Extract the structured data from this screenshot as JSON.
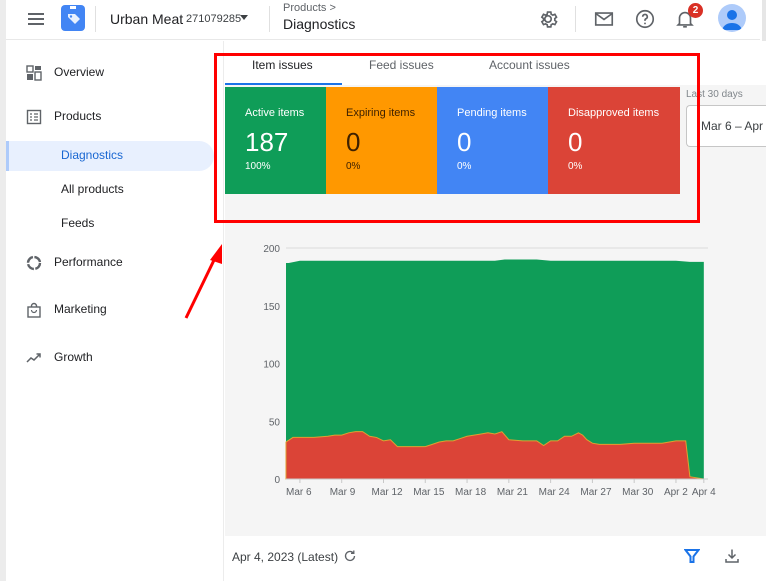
{
  "header": {
    "menu_icon": "hamburger-menu-icon",
    "logo_icon": "merchant-center-tag-icon",
    "account_name": "Urban Meat",
    "account_id": "271079285",
    "breadcrumb_parent": "Products >",
    "page_title": "Diagnostics",
    "icons": [
      "gear-icon",
      "mail-icon",
      "help-icon",
      "bell-icon",
      "avatar"
    ],
    "notification_count": "2"
  },
  "sidebar": {
    "items": [
      {
        "label": "Overview",
        "icon": "dashboard-icon"
      },
      {
        "label": "Products",
        "icon": "list-icon"
      },
      {
        "label": "Diagnostics",
        "sub": true,
        "active": true
      },
      {
        "label": "All products",
        "sub": true
      },
      {
        "label": "Feeds",
        "sub": true
      },
      {
        "label": "Performance",
        "icon": "donut-icon"
      },
      {
        "label": "Marketing",
        "icon": "shopping-bag-icon"
      },
      {
        "label": "Growth",
        "icon": "trending-up-icon"
      }
    ]
  },
  "tabs": [
    {
      "label": "Item issues",
      "active": true
    },
    {
      "label": "Feed issues"
    },
    {
      "label": "Account issues"
    }
  ],
  "cards": [
    {
      "label": "Active items",
      "value": "187",
      "pct": "100%",
      "color": "#0f9d58"
    },
    {
      "label": "Expiring items",
      "value": "0",
      "pct": "0%",
      "color": "#ff9800"
    },
    {
      "label": "Pending items",
      "value": "0",
      "pct": "0%",
      "color": "#4285f4"
    },
    {
      "label": "Disapproved items",
      "value": "0",
      "pct": "0%",
      "color": "#db4437"
    }
  ],
  "date_range": {
    "label": "Last 30 days",
    "value": "Mar 6 – Apr"
  },
  "footer": {
    "date": "Apr 4, 2023 (Latest)",
    "icons": [
      "refresh-icon",
      "filter-icon",
      "download-icon"
    ]
  },
  "chart_data": {
    "type": "area",
    "title": "",
    "xlabel": "",
    "ylabel": "",
    "ylim": [
      0,
      200
    ],
    "yticks": [
      0,
      50,
      100,
      150,
      200
    ],
    "grid": true,
    "x_start": "Mar 5",
    "x_end": "Apr 4",
    "xtick_labels": [
      "Mar 6",
      "Mar 9",
      "Mar 12",
      "Mar 15",
      "Mar 18",
      "Mar 21",
      "Mar 24",
      "Mar 27",
      "Mar 30",
      "Apr 2",
      "Apr 4"
    ],
    "xtick_days": [
      1,
      4,
      7,
      10,
      13,
      16,
      19,
      22,
      25,
      28,
      30
    ],
    "series": [
      {
        "name": "Active items",
        "color": "#0f9d58",
        "x": [
          0,
          0.2,
          1,
          2,
          3,
          4,
          5,
          6,
          7,
          8,
          9,
          10,
          11,
          12,
          13,
          14,
          15,
          15.7,
          16,
          17,
          18,
          19,
          20,
          21,
          22,
          23,
          24,
          25,
          26,
          27,
          28,
          29,
          30
        ],
        "values": [
          187,
          187,
          189,
          189,
          189,
          189,
          189,
          189,
          189,
          189,
          189,
          189,
          189,
          189,
          189,
          189,
          189,
          190,
          190,
          190,
          190,
          189,
          189,
          189,
          189,
          189,
          189,
          189,
          189,
          189,
          189,
          188,
          188
        ]
      },
      {
        "name": "Disapproved items",
        "color": "#db4437",
        "x": [
          0,
          0.5,
          1,
          2,
          3,
          3.5,
          4,
          4.5,
          5,
          5.5,
          6,
          6.5,
          7,
          7.5,
          8,
          9,
          10,
          10.5,
          11,
          11.5,
          12,
          12.5,
          13,
          13.5,
          14,
          14.5,
          15,
          15.5,
          16,
          17,
          18,
          18.5,
          19,
          19.5,
          20,
          20.5,
          21,
          21.3,
          21.6,
          22,
          22.5,
          23,
          24,
          25,
          26,
          27,
          28,
          28.7,
          29,
          30
        ],
        "values": [
          32,
          36,
          36,
          36,
          37,
          38,
          38,
          40,
          41,
          41,
          37,
          36,
          33,
          34,
          28,
          28,
          28,
          30,
          32,
          33,
          33,
          35,
          37,
          38,
          39,
          40,
          39,
          41,
          34,
          33,
          33,
          29,
          33,
          33,
          37,
          37,
          40,
          38,
          34,
          31,
          30,
          30,
          30,
          31,
          31,
          31,
          33,
          33,
          2,
          0
        ]
      }
    ]
  }
}
